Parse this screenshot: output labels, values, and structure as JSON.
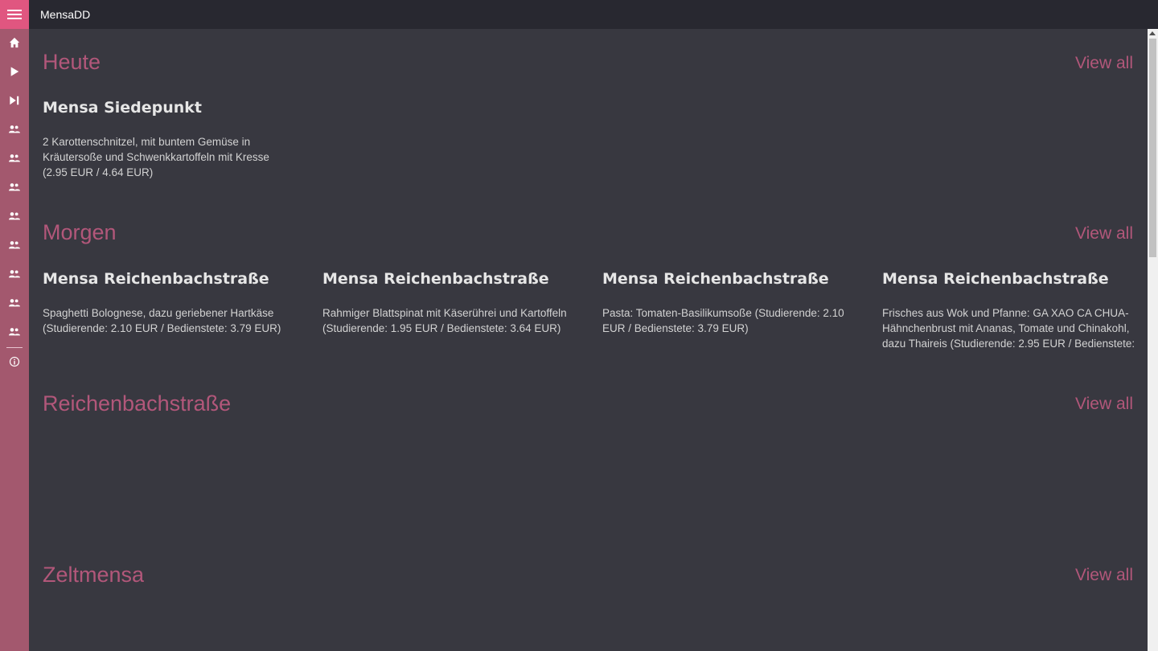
{
  "app": {
    "title": "MensaDD"
  },
  "sidebar": {
    "icons": [
      "hamburger-menu-icon",
      "home-icon",
      "play-icon",
      "skip-next-icon",
      "mensa-icon",
      "mensa-icon",
      "mensa-icon",
      "mensa-icon",
      "mensa-icon",
      "mensa-icon",
      "mensa-icon",
      "mensa-icon",
      "info-icon"
    ]
  },
  "colors": {
    "accent": "#b2577a",
    "sidebar": "#a3586e",
    "hamburger": "#e05680",
    "background": "#383840",
    "titlebar": "#282830"
  },
  "sections": [
    {
      "title": "Heute",
      "view_all": "View all",
      "cards": [
        {
          "title": "Mensa Siedepunkt",
          "text": "2 Karottenschnitzel, mit buntem Gemüse in Kräutersoße und Schwenkkartoffeln mit Kresse (2.95 EUR / 4.64 EUR)"
        }
      ]
    },
    {
      "title": "Morgen",
      "view_all": "View all",
      "cards": [
        {
          "title": "Mensa Reichenbachstraße",
          "text": "Spaghetti Bolognese, dazu geriebener Hartkäse (Studierende: 2.10 EUR / Bedienstete: 3.79 EUR)"
        },
        {
          "title": "Mensa Reichenbachstraße",
          "text": "Rahmiger Blattspinat mit Käserührei und Kartoffeln (Studierende: 1.95 EUR / Bedienstete: 3.64 EUR)"
        },
        {
          "title": "Mensa Reichenbachstraße",
          "text": "Pasta: Tomaten-Basilikumsoße (Studierende: 2.10 EUR / Bedienstete: 3.79 EUR)"
        },
        {
          "title": "Mensa Reichenbachstraße",
          "text": "Frisches aus Wok und Pfanne: GA XAO CA CHUA-Hähnchenbrust mit Ananas, Tomate und Chinakohl, dazu Thaireis (Studierende: 2.95 EUR / Bedienstete:"
        }
      ]
    },
    {
      "title": "Reichenbachstraße",
      "view_all": "View all"
    },
    {
      "title": "Zeltmensa",
      "view_all": "View all"
    }
  ]
}
